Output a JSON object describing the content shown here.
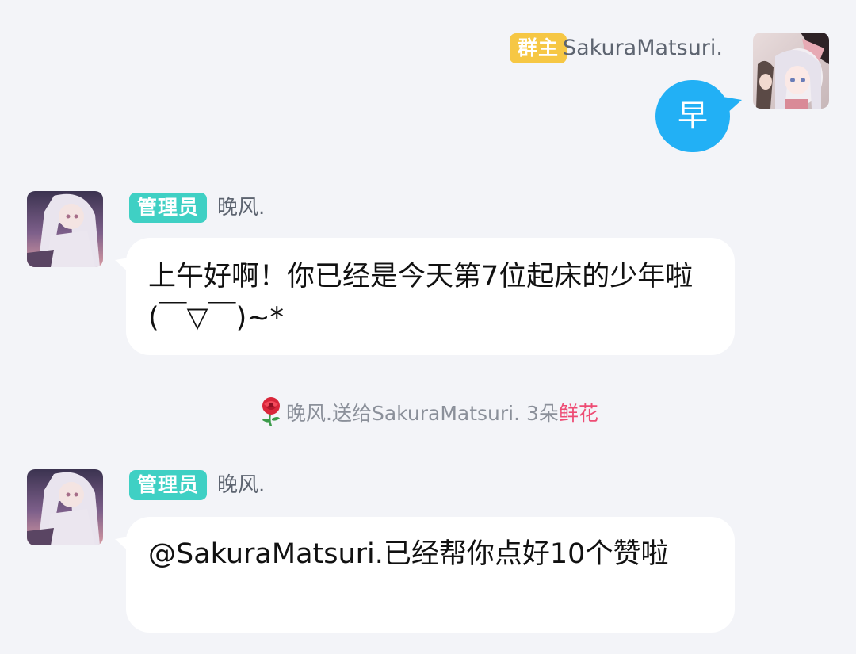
{
  "messages": [
    {
      "side": "right",
      "badge": "群主",
      "sender": "SakuraMatsuri.",
      "text": "早"
    },
    {
      "side": "left",
      "badge": "管理员",
      "sender": "晚风.",
      "text": "上午好啊！你已经是今天第7位起床的少年啦(￣▽￣)~*"
    },
    {
      "side": "left",
      "badge": "管理员",
      "sender": "晚风.",
      "text": "@SakuraMatsuri.已经帮你点好10个赞啦"
    }
  ],
  "system_notice": {
    "icon": "rose-icon",
    "prefix": "晚风.送给SakuraMatsuri. 3朵",
    "gift": "鲜花"
  },
  "colors": {
    "background": "#f3f4f8",
    "owner_badge": "#f6c744",
    "admin_badge": "#3fd0c4",
    "self_bubble": "#22b0f5",
    "gift_highlight": "#ee4c74"
  }
}
